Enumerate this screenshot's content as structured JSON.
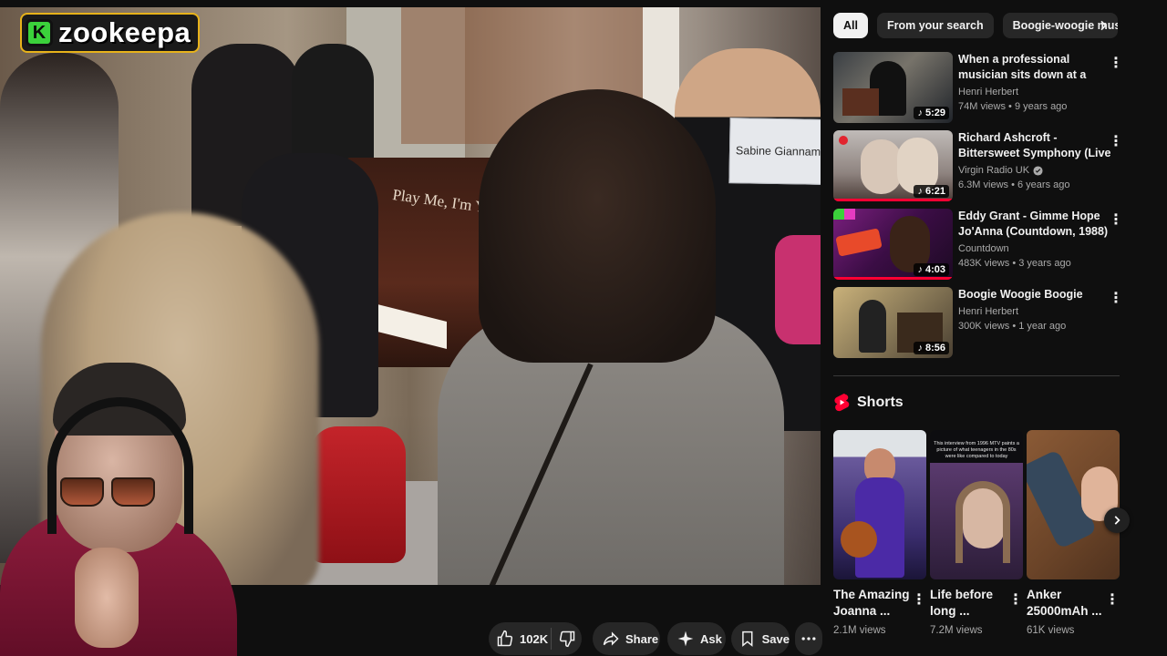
{
  "logo": {
    "badge": "K",
    "text": "zookeepa"
  },
  "video": {
    "piano_text": "Play Me, I'm Yours",
    "sign_text": "Sabine Giannam"
  },
  "actions": {
    "like_count": "102K",
    "share_label": "Share",
    "ask_label": "Ask",
    "save_label": "Save"
  },
  "chips": [
    {
      "label": "All"
    },
    {
      "label": "From your search"
    },
    {
      "label": "Boogie-woogie music"
    }
  ],
  "recommendations": [
    {
      "title": "When a professional musician sits down at a public piano",
      "channel": "Henri Herbert",
      "verified": false,
      "views": "74M views",
      "age": "9 years ago",
      "duration": "5:29"
    },
    {
      "title": "Richard Ashcroft - Bittersweet Symphony (Live on The Chris ...",
      "channel": "Virgin Radio UK",
      "verified": true,
      "views": "6.3M views",
      "age": "6 years ago",
      "duration": "6:21"
    },
    {
      "title": "Eddy Grant - Gimme Hope Jo'Anna (Countdown, 1988)",
      "channel": "Countdown",
      "verified": false,
      "views": "483K views",
      "age": "3 years ago",
      "duration": "4:03"
    },
    {
      "title": "Boogie Woogie Boogie",
      "channel": "Henri Herbert",
      "verified": false,
      "views": "300K views",
      "age": "1 year ago",
      "duration": "8:56"
    }
  ],
  "shorts": {
    "heading": "Shorts",
    "items": [
      {
        "title": "The Amazing Joanna ...",
        "views": "2.1M views"
      },
      {
        "title": "Life before long ...",
        "views": "7.2M views",
        "overlay_text": "This interview from 1996 MTV paints a picture of what teenagers in the 80s were like compared to today"
      },
      {
        "title": "Anker 25000mAh ...",
        "views": "61K views"
      }
    ]
  },
  "colors": {
    "background": "#0f0f0f",
    "accent": "#ff0033",
    "logo_border": "#e7b21a",
    "logo_badge": "#3bd13b"
  }
}
